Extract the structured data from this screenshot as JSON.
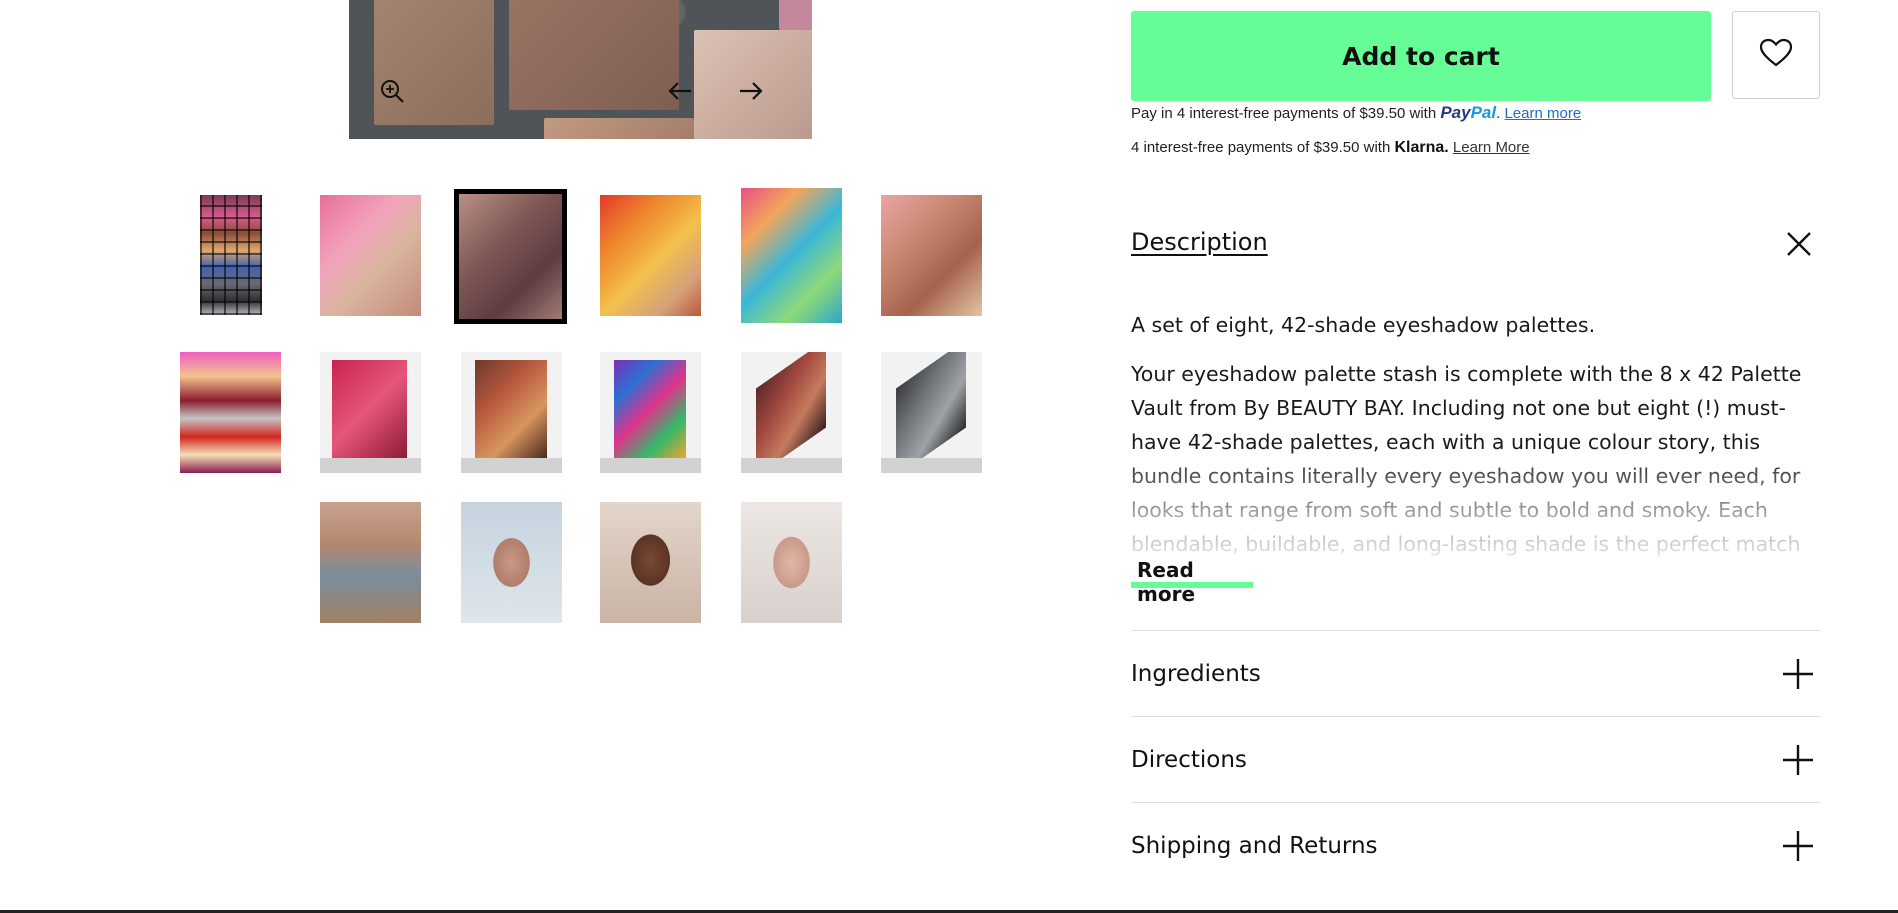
{
  "gallery": {
    "main_image_alt": "",
    "controls": {
      "zoom_icon": "zoom-in-icon",
      "prev_icon": "arrow-left-icon",
      "next_icon": "arrow-right-icon"
    },
    "thumbnails": [
      {
        "kind": "palette-stack",
        "selected": false
      },
      {
        "kind": "swatch-hand",
        "selected": false
      },
      {
        "kind": "swatch-hand",
        "selected": true
      },
      {
        "kind": "swatch-hand",
        "selected": false
      },
      {
        "kind": "swatch-hand",
        "selected": false
      },
      {
        "kind": "swatch-hand",
        "selected": false
      },
      {
        "kind": "palette-grid",
        "selected": false
      },
      {
        "kind": "palette-open",
        "selected": false
      },
      {
        "kind": "palette-open",
        "selected": false
      },
      {
        "kind": "palette-open",
        "selected": false
      },
      {
        "kind": "palette-tilted",
        "selected": false
      },
      {
        "kind": "palette-tilted",
        "selected": false
      },
      {
        "kind": "model-face",
        "selected": false
      },
      {
        "kind": "model-face",
        "selected": false
      },
      {
        "kind": "model-face",
        "selected": false
      },
      {
        "kind": "model-face",
        "selected": false
      }
    ]
  },
  "purchase": {
    "add_to_cart_label": "Add to cart",
    "wishlist_icon": "heart-icon",
    "paypal": {
      "prefix": "Pay in 4 interest-free payments of $39.50 with",
      "logo_pay": "Pay",
      "logo_pal": "Pal",
      "suffix": ".",
      "link": "Learn more"
    },
    "klarna": {
      "prefix": "4 interest-free payments of $39.50 with",
      "logo": "Klarna.",
      "link": "Learn More"
    }
  },
  "description": {
    "heading": "Description",
    "close_icon": "close-icon",
    "intro": "A set of eight, 42-shade eyeshadow palettes.",
    "body": "Your eyeshadow palette stash is complete with the 8 x 42 Palette Vault from By BEAUTY BAY. Including not one but eight (!) must-have 42-shade palettes, each with a unique colour story, this bundle contains literally every eyeshadow you will ever need, for looks that range from soft and subtle to bold and smoky. Each blendable, buildable, and long-lasting shade is the perfect match for your next",
    "read_more": "Read more"
  },
  "accordion": [
    {
      "label": "Ingredients",
      "icon": "plus-icon"
    },
    {
      "label": "Directions",
      "icon": "plus-icon"
    },
    {
      "label": "Shipping and Returns",
      "icon": "plus-icon"
    }
  ],
  "colors": {
    "accent_green": "#67fd96",
    "paypal_blue": "#253b80",
    "paypal_light_blue": "#179bd7",
    "link_blue": "#1f6fc9"
  }
}
